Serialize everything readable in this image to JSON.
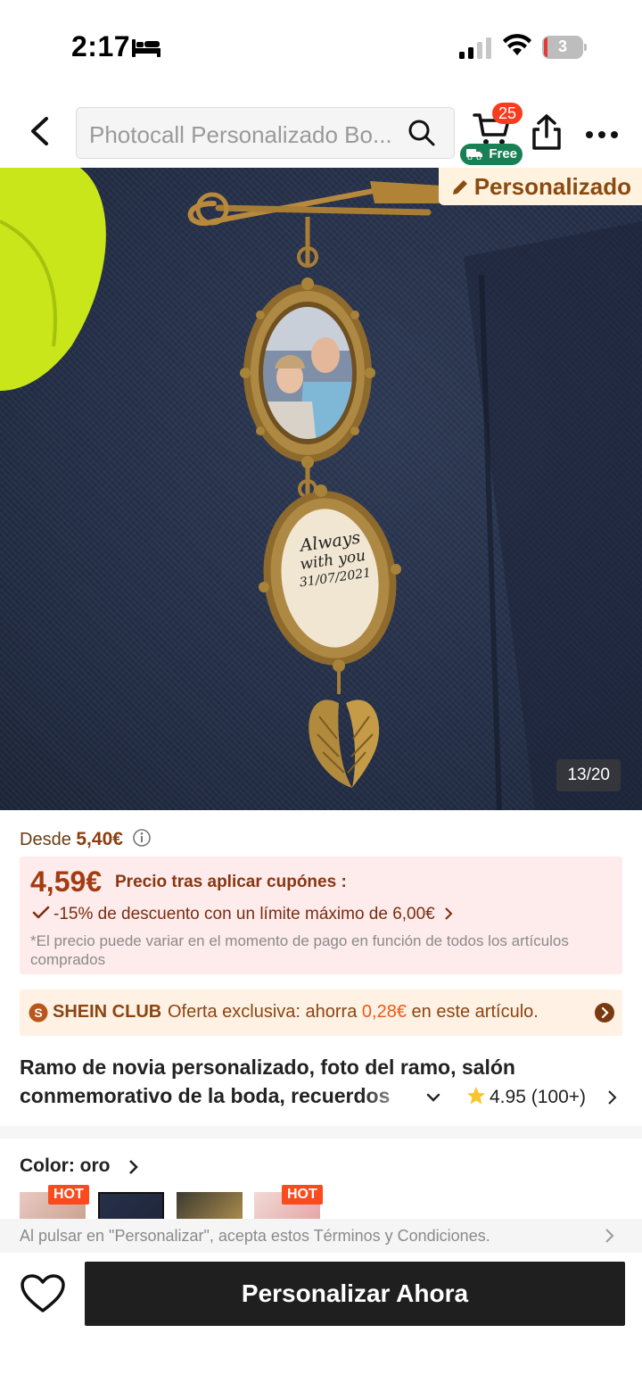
{
  "status_bar": {
    "time": "2:17",
    "battery_level": "3",
    "icons": [
      "bed-icon",
      "signal-icon",
      "wifi-icon",
      "battery-icon"
    ]
  },
  "header": {
    "search_placeholder": "Photocall Personalizado Bo...",
    "cart_count": "25",
    "free_shipping_label": "Free",
    "icons": [
      "back-arrow-icon",
      "search-icon",
      "cart-icon",
      "share-icon",
      "more-icon"
    ]
  },
  "product_image": {
    "customized_tag": "Personalizado",
    "counter": "13/20",
    "pendant_text": [
      "Always",
      "with you",
      "31/07/2021"
    ]
  },
  "price": {
    "from_prefix": "Desde",
    "from_value": "5,40€",
    "coupon_price": "4,59€",
    "coupon_label": "Precio tras aplicar cupónes :",
    "discount_text": "-15% de descuento con un límite máximo de 6,00€",
    "note": "*El precio puede variar en el momento de pago en función de todos los artículos comprados"
  },
  "club": {
    "name": "SHEIN CLUB",
    "text_before": "Oferta exclusiva: ahorra",
    "amount": "0,28€",
    "text_after": "en este artículo."
  },
  "product": {
    "title_line1": "Ramo de novia personalizado, foto del ramo, salón",
    "title_line2": "conmemorativo de la boda, recuerdos",
    "rating": "4.95",
    "review_count": "(100+)"
  },
  "options": {
    "color_label": "Color: oro",
    "hot_label": "HOT"
  },
  "footer": {
    "terms": "Al pulsar en \"Personalizar\", acepta estos Términos y Condiciones.",
    "cta_label": "Personalizar Ahora"
  },
  "colors": {
    "price_brown": "#a23b12",
    "coupon_bg": "#fdeceb",
    "club_bg": "#fff1e3",
    "hot_red": "#fa4a1e",
    "free_green": "#198055",
    "cta_black": "#1f1f1f"
  }
}
